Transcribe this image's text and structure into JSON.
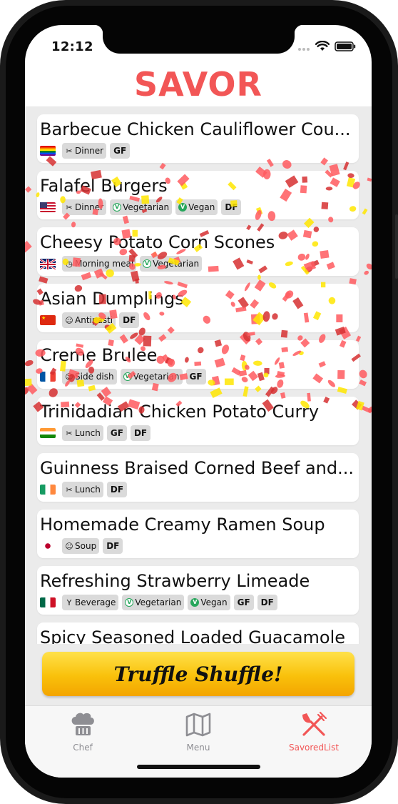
{
  "status": {
    "time": "12:12"
  },
  "app_title": "SAVOR",
  "recipes": [
    {
      "title": "Barbecue Chicken Cauliflower Cou...",
      "flag": "rainbow",
      "tags": [
        {
          "icon": "utensils-icon",
          "label": "Dinner"
        }
      ],
      "badges": [
        "GF"
      ]
    },
    {
      "title": "Falafel Burgers",
      "flag": "us",
      "tags": [
        {
          "icon": "utensils-icon",
          "label": "Dinner"
        },
        {
          "icon": "vegetarian-icon",
          "label": "Vegetarian"
        },
        {
          "icon": "vegan-icon",
          "label": "Vegan"
        }
      ],
      "badges": [
        "DF"
      ]
    },
    {
      "title": "Cheesy Potato Corn Scones",
      "flag": "uk",
      "tags": [
        {
          "icon": "clock-icon",
          "label": "Morning meal"
        },
        {
          "icon": "vegetarian-icon",
          "label": "Vegetarian"
        }
      ],
      "badges": []
    },
    {
      "title": "Asian Dumplings",
      "flag": "china",
      "tags": [
        {
          "icon": "smile-icon",
          "label": "Antipasti"
        }
      ],
      "badges": [
        "DF"
      ]
    },
    {
      "title": "Creme Brulee",
      "flag": "france",
      "tags": [
        {
          "icon": "smile-icon",
          "label": "Side dish"
        },
        {
          "icon": "vegetarian-icon",
          "label": "Vegetarian"
        }
      ],
      "badges": [
        "GF"
      ]
    },
    {
      "title": "Trinidadian Chicken Potato Curry",
      "flag": "india",
      "tags": [
        {
          "icon": "utensils-icon",
          "label": "Lunch"
        }
      ],
      "badges": [
        "GF",
        "DF"
      ]
    },
    {
      "title": "Guinness Braised Corned Beef and...",
      "flag": "ireland",
      "tags": [
        {
          "icon": "utensils-icon",
          "label": "Lunch"
        }
      ],
      "badges": [
        "DF"
      ]
    },
    {
      "title": "Homemade Creamy Ramen Soup",
      "flag": "japan",
      "tags": [
        {
          "icon": "smile-icon",
          "label": "Soup"
        }
      ],
      "badges": [
        "DF"
      ]
    },
    {
      "title": "Refreshing Strawberry Limeade",
      "flag": "mexico",
      "tags": [
        {
          "icon": "glass-icon",
          "label": "Beverage"
        },
        {
          "icon": "vegetarian-icon",
          "label": "Vegetarian"
        },
        {
          "icon": "vegan-icon",
          "label": "Vegan"
        }
      ],
      "badges": [
        "GF",
        "DF"
      ]
    },
    {
      "title": "Spicy Seasoned Loaded Guacamole",
      "flag": "",
      "tags": [],
      "badges": []
    }
  ],
  "shuffle_button": "Truffle Shuffle!",
  "tabs": [
    {
      "label": "Chef",
      "icon": "chef-hat-icon",
      "active": false
    },
    {
      "label": "Menu",
      "icon": "map-icon",
      "active": false
    },
    {
      "label": "SavoredList",
      "icon": "utensils-icon",
      "active": true
    }
  ],
  "colors": {
    "accent": "#f25656",
    "tab_inactive": "#8e8e93",
    "button": "#f9c10b",
    "confetti_red": "#ff5a5f",
    "confetti_yellow": "#ffe600"
  }
}
